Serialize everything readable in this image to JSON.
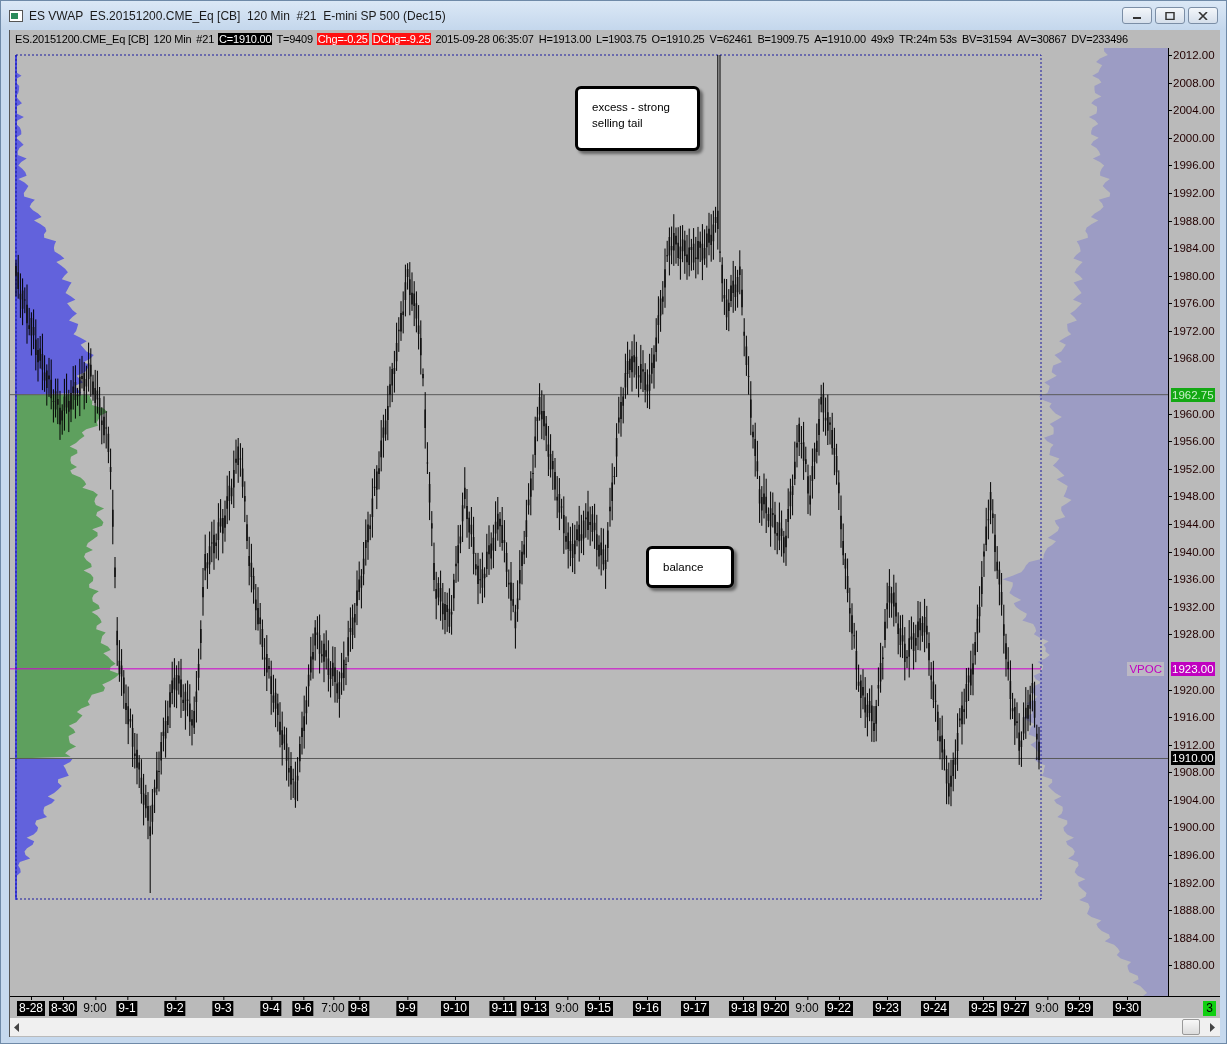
{
  "window": {
    "title": "ES VWAP  ES.20151200.CME_Eq [CB]  120 Min  #21  E-mini SP 500 (Dec15)"
  },
  "header": [
    {
      "text": "ES.20151200.CME_Eq [CB]",
      "kind": "plain"
    },
    {
      "text": "120 Min",
      "kind": "plain"
    },
    {
      "text": "#21",
      "kind": "plain"
    },
    {
      "text": "C=1910.00",
      "kind": "black"
    },
    {
      "text": "T=9409",
      "kind": "plain"
    },
    {
      "text": "Chg=-0.25",
      "kind": "red"
    },
    {
      "text": "DChg=-9.25",
      "kind": "red"
    },
    {
      "text": "2015-09-28 06:35:07",
      "kind": "plain"
    },
    {
      "text": "H=1913.00",
      "kind": "plain"
    },
    {
      "text": "L=1903.75",
      "kind": "plain"
    },
    {
      "text": "O=1910.25",
      "kind": "plain"
    },
    {
      "text": "V=62461",
      "kind": "plain"
    },
    {
      "text": "B=1909.75",
      "kind": "plain"
    },
    {
      "text": "A=1910.00",
      "kind": "plain"
    },
    {
      "text": "49x9",
      "kind": "plain"
    },
    {
      "text": "TR:24m 53s",
      "kind": "plain"
    },
    {
      "text": "BV=31594",
      "kind": "plain"
    },
    {
      "text": "AV=30867",
      "kind": "plain"
    },
    {
      "text": "DV=233496",
      "kind": "plain"
    }
  ],
  "notes": [
    {
      "text": "excess - strong selling tail"
    },
    {
      "text": "balance"
    }
  ],
  "price_axis": {
    "ticks": [
      "2012.00",
      "2008.00",
      "2004.00",
      "2000.00",
      "1996.00",
      "1992.00",
      "1988.00",
      "1984.00",
      "1980.00",
      "1976.00",
      "1972.00",
      "1968.00",
      "1960.00",
      "1956.00",
      "1952.00",
      "1948.00",
      "1944.00",
      "1940.00",
      "1936.00",
      "1932.00",
      "1928.00",
      "1920.00",
      "1916.00",
      "1912.00",
      "1908.00",
      "1904.00",
      "1900.00",
      "1896.00",
      "1892.00",
      "1888.00",
      "1884.00",
      "1880.00"
    ],
    "markers": [
      {
        "text": "1962.75",
        "kind": "green"
      },
      {
        "text": "1923.00",
        "kind": "magenta",
        "tag": "VPOC"
      },
      {
        "text": "1910.00",
        "kind": "black"
      }
    ]
  },
  "x_axis": [
    {
      "text": "8-28",
      "kind": "date"
    },
    {
      "text": "8-30",
      "kind": "date"
    },
    {
      "text": "9:00",
      "kind": "time"
    },
    {
      "text": "9-1",
      "kind": "date"
    },
    {
      "text": "9-2",
      "kind": "date"
    },
    {
      "text": "9-3",
      "kind": "date"
    },
    {
      "text": "9-4",
      "kind": "date"
    },
    {
      "text": "9-6",
      "kind": "date"
    },
    {
      "text": "7:00",
      "kind": "time"
    },
    {
      "text": "9-8",
      "kind": "date"
    },
    {
      "text": "9-9",
      "kind": "date"
    },
    {
      "text": "9-10",
      "kind": "date"
    },
    {
      "text": "9-11",
      "kind": "date"
    },
    {
      "text": "9-13",
      "kind": "date"
    },
    {
      "text": "9:00",
      "kind": "time"
    },
    {
      "text": "9-15",
      "kind": "date"
    },
    {
      "text": "9-16",
      "kind": "date"
    },
    {
      "text": "9-17",
      "kind": "date"
    },
    {
      "text": "9-18",
      "kind": "date"
    },
    {
      "text": "9-20",
      "kind": "date"
    },
    {
      "text": "9:00",
      "kind": "time"
    },
    {
      "text": "9-22",
      "kind": "date"
    },
    {
      "text": "9-23",
      "kind": "date"
    },
    {
      "text": "9-24",
      "kind": "date"
    },
    {
      "text": "9-25",
      "kind": "date"
    },
    {
      "text": "9-27",
      "kind": "date"
    },
    {
      "text": "9:00",
      "kind": "time"
    },
    {
      "text": "9-29",
      "kind": "date"
    },
    {
      "text": "9-30",
      "kind": "date"
    }
  ],
  "corner_badge": "3"
}
